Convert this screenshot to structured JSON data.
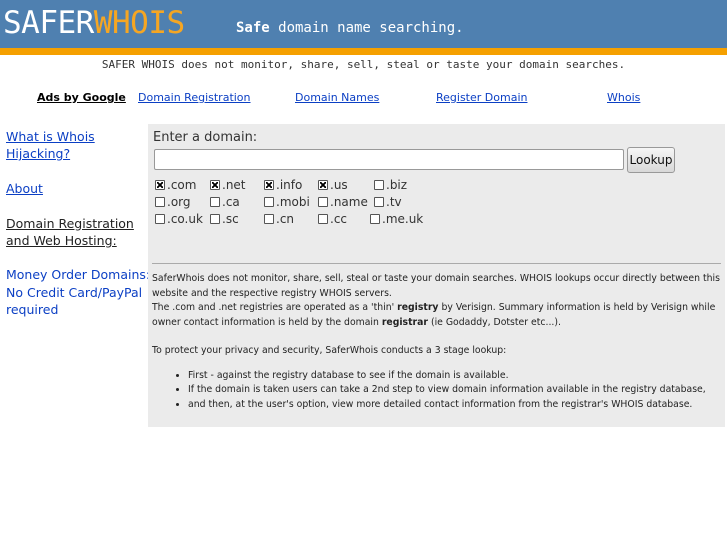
{
  "header": {
    "logo_part1": "SAFER",
    "logo_part2": "WHOIS",
    "tagline_bold": "Safe",
    "tagline_rest": " domain name searching."
  },
  "notice": "SAFER WHOIS does not monitor, share, sell, steal or taste your domain searches.",
  "adbar": {
    "label": "Ads by Google",
    "links": [
      "Domain Registration",
      "Domain Names",
      "Register Domain",
      "Whois"
    ]
  },
  "sidebar": {
    "hijacking_line1": "What is Whois",
    "hijacking_line2": "Hijacking?",
    "about": "About",
    "hosting_line1": "Domain Registration",
    "hosting_line2": "and Web Hosting:",
    "money_line1": "Money Order Domains:",
    "money_line2": "No Credit Card/PayPal",
    "money_line3": "required"
  },
  "form": {
    "label": "Enter a domain:",
    "input_value": "",
    "button_label": "Lookup",
    "tlds": [
      {
        "label": ".com",
        "checked": true
      },
      {
        "label": ".net",
        "checked": true
      },
      {
        "label": ".info",
        "checked": true
      },
      {
        "label": ".us",
        "checked": true
      },
      {
        "label": ".biz",
        "checked": false
      },
      {
        "label": ".org",
        "checked": false
      },
      {
        "label": ".ca",
        "checked": false
      },
      {
        "label": ".mobi",
        "checked": false
      },
      {
        "label": ".name",
        "checked": false
      },
      {
        "label": ".tv",
        "checked": false
      },
      {
        "label": ".co.uk",
        "checked": false
      },
      {
        "label": ".sc",
        "checked": false
      },
      {
        "label": ".cn",
        "checked": false
      },
      {
        "label": ".cc",
        "checked": false
      },
      {
        "label": ".me.uk",
        "checked": false
      }
    ]
  },
  "info": {
    "p1": "SaferWhois does not monitor, share, sell, steal or taste your domain searches. WHOIS lookups occur directly between this website and the respective registry WHOIS servers.",
    "p2_a": "The .com and .net registries are operated as a 'thin' ",
    "p2_b": "registry",
    "p2_c": " by Verisign. Summary information is held by Verisign while owner contact information is held by the domain ",
    "p2_d": "registrar",
    "p2_e": " (ie Godaddy, Dotster etc...).",
    "p3": "To protect your privacy and security, SaferWhois conducts a 3 stage lookup:",
    "steps": [
      "First - against the registry database to see if the domain is available.",
      "If the domain is taken users can take a 2nd step to view domain information available in the registry database,",
      "and then, at the user's option, view more detailed contact information from the registrar's WHOIS database."
    ]
  }
}
